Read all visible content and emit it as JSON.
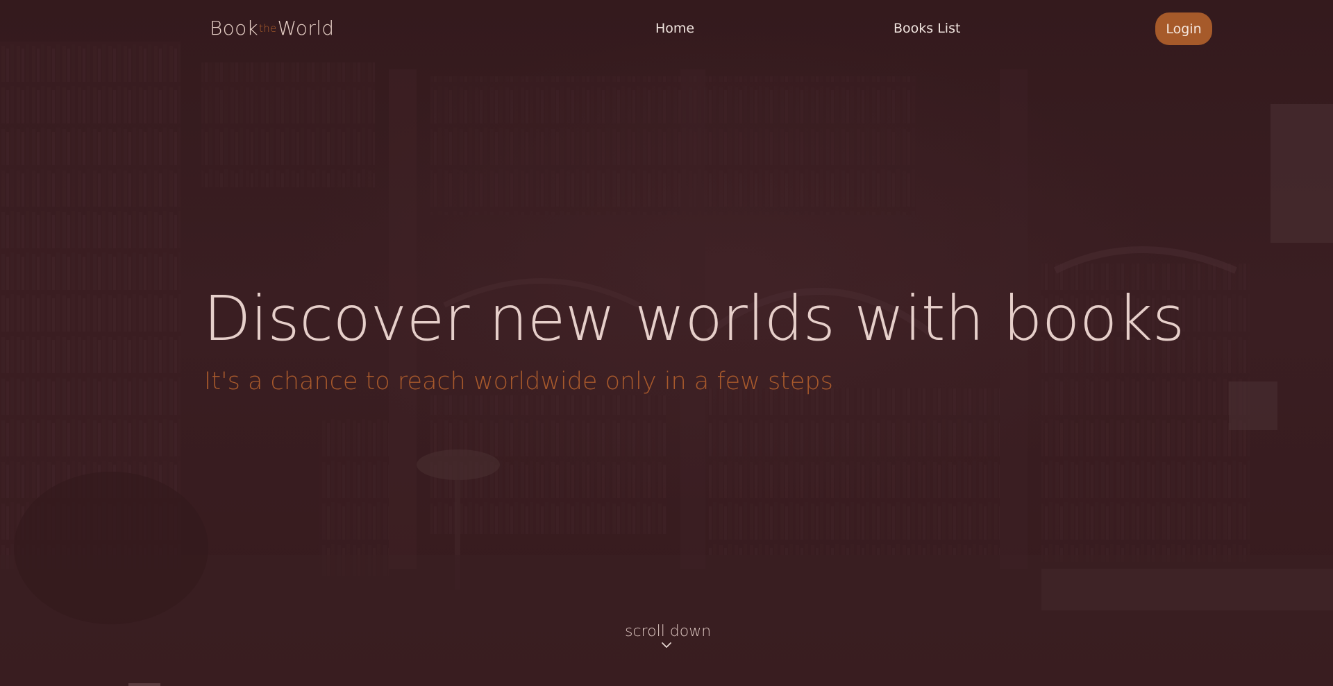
{
  "nav": {
    "logo": {
      "part1": "Book",
      "part2": "the",
      "part3": "World"
    },
    "links": [
      {
        "label": "Home"
      },
      {
        "label": "Books List"
      }
    ],
    "login_label": "Login"
  },
  "hero": {
    "title": "Discover new worlds with books",
    "subtitle": "It's a chance to reach worldwide only in a few steps"
  },
  "scroll": {
    "label": "scroll down",
    "icon": "chevron-down-icon"
  },
  "colors": {
    "background": "#361a1e",
    "accent": "#a95a2c",
    "button": "#a65a2a",
    "text_light": "#e6cfca"
  }
}
